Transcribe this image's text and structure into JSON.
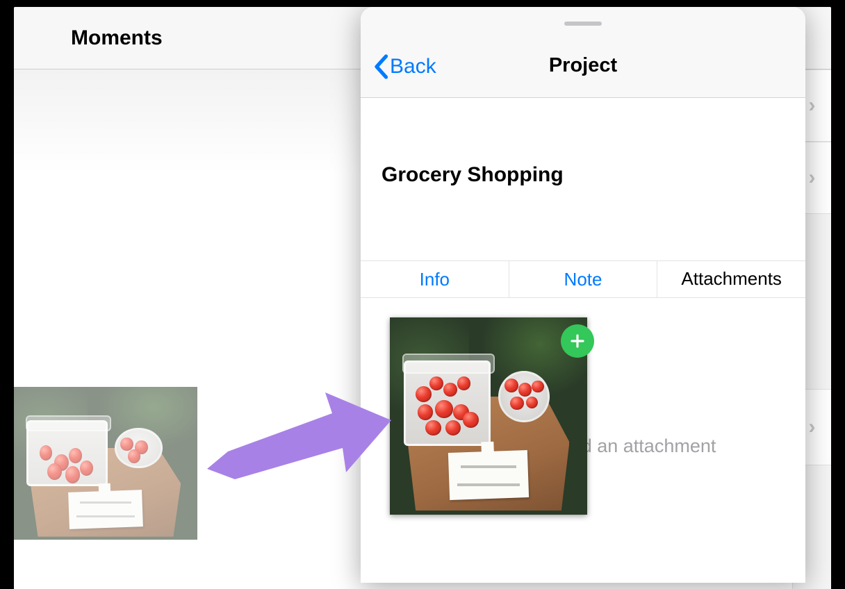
{
  "left": {
    "title": "Moments"
  },
  "popover": {
    "back_label": "Back",
    "title": "Project",
    "project_name": "Grocery Shopping",
    "tabs": {
      "info": "Info",
      "note": "Note",
      "attachments": "Attachments",
      "selected": "Attachments"
    },
    "attach_hint": "Tap below to add an attachment"
  },
  "colors": {
    "ios_blue": "#007aff",
    "ios_green": "#34c759",
    "arrow": "#a881e6"
  }
}
